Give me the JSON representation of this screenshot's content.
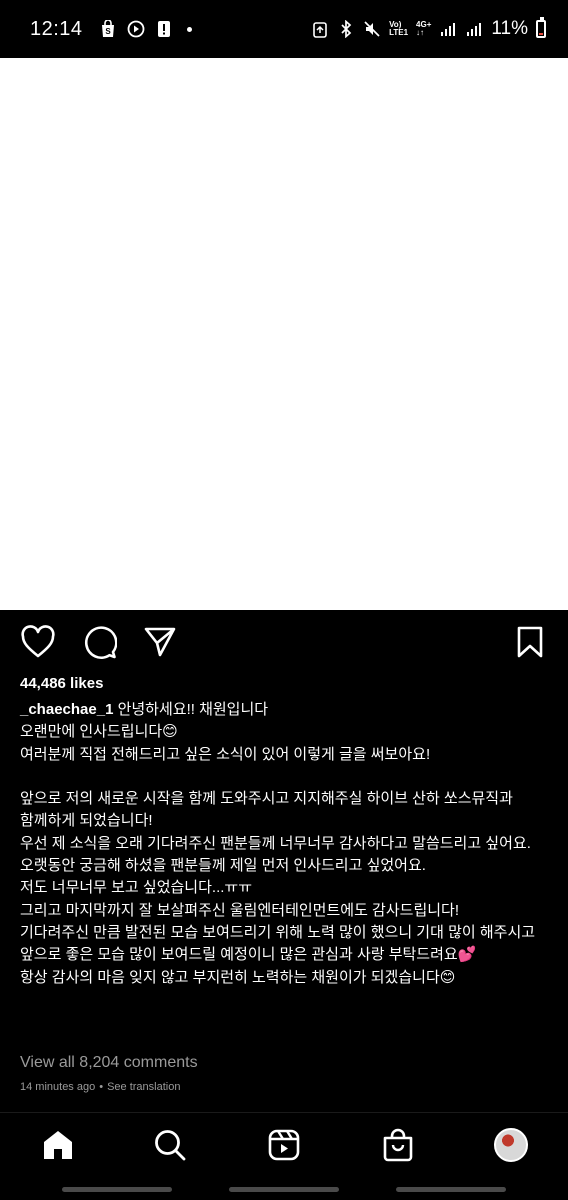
{
  "status_bar": {
    "time": "12:14",
    "net_top": "Vo)",
    "net_bottom": "LTE1",
    "net2_top": "4G+",
    "battery": "11%",
    "battery_level": 0.11,
    "battery_color": "#e74c3c",
    "icons": [
      "shopping-bag-icon",
      "play-circle-icon",
      "alert-icon",
      "dot-icon",
      "recycle-icon",
      "bluetooth-icon",
      "mute-icon",
      "signal-icon",
      "signal-icon",
      "battery-icon"
    ]
  },
  "post": {
    "likes": "44,486 likes",
    "username": "_chaechae_1",
    "caption": " 안녕하세요!! 채원입니다\n오랜만에 인사드립니다😊\n여러분께 직접 전해드리고 싶은 소식이 있어 이렇게 글을 써보아요!\n\n앞으로 저의 새로운 시작을 함께 도와주시고 지지해주실 하이브 산하 쏘스뮤직과 함께하게 되었습니다!\n우선 제 소식을 오래 기다려주신 팬분들께 너무너무 감사하다고 말씀드리고 싶어요.\n오랫동안 궁금해 하셨을 팬분들께 제일 먼저 인사드리고 싶었어요.\n저도 너무너무 보고 싶었습니다...ㅠㅠ\n그리고 마지막까지 잘 보살펴주신 울림엔터테인먼트에도 감사드립니다!\n기다려주신 만큼 발전된 모습 보여드리기 위해 노력 많이 했으니 기대 많이 해주시고\n앞으로 좋은 모습 많이 보여드릴 예정이니 많은 관심과 사랑 부탁드려요💕\n항상 감사의 마음 잊지 않고 부지런히 노력하는 채원이가 되겠습니다😊",
    "view_comments": "View all 8,204 comments",
    "time_ago": "14 minutes ago",
    "separator": "•",
    "see_translation": "See translation"
  },
  "nav": {
    "items": [
      "home-icon",
      "search-icon",
      "reels-icon",
      "shop-icon",
      "profile-avatar"
    ]
  }
}
